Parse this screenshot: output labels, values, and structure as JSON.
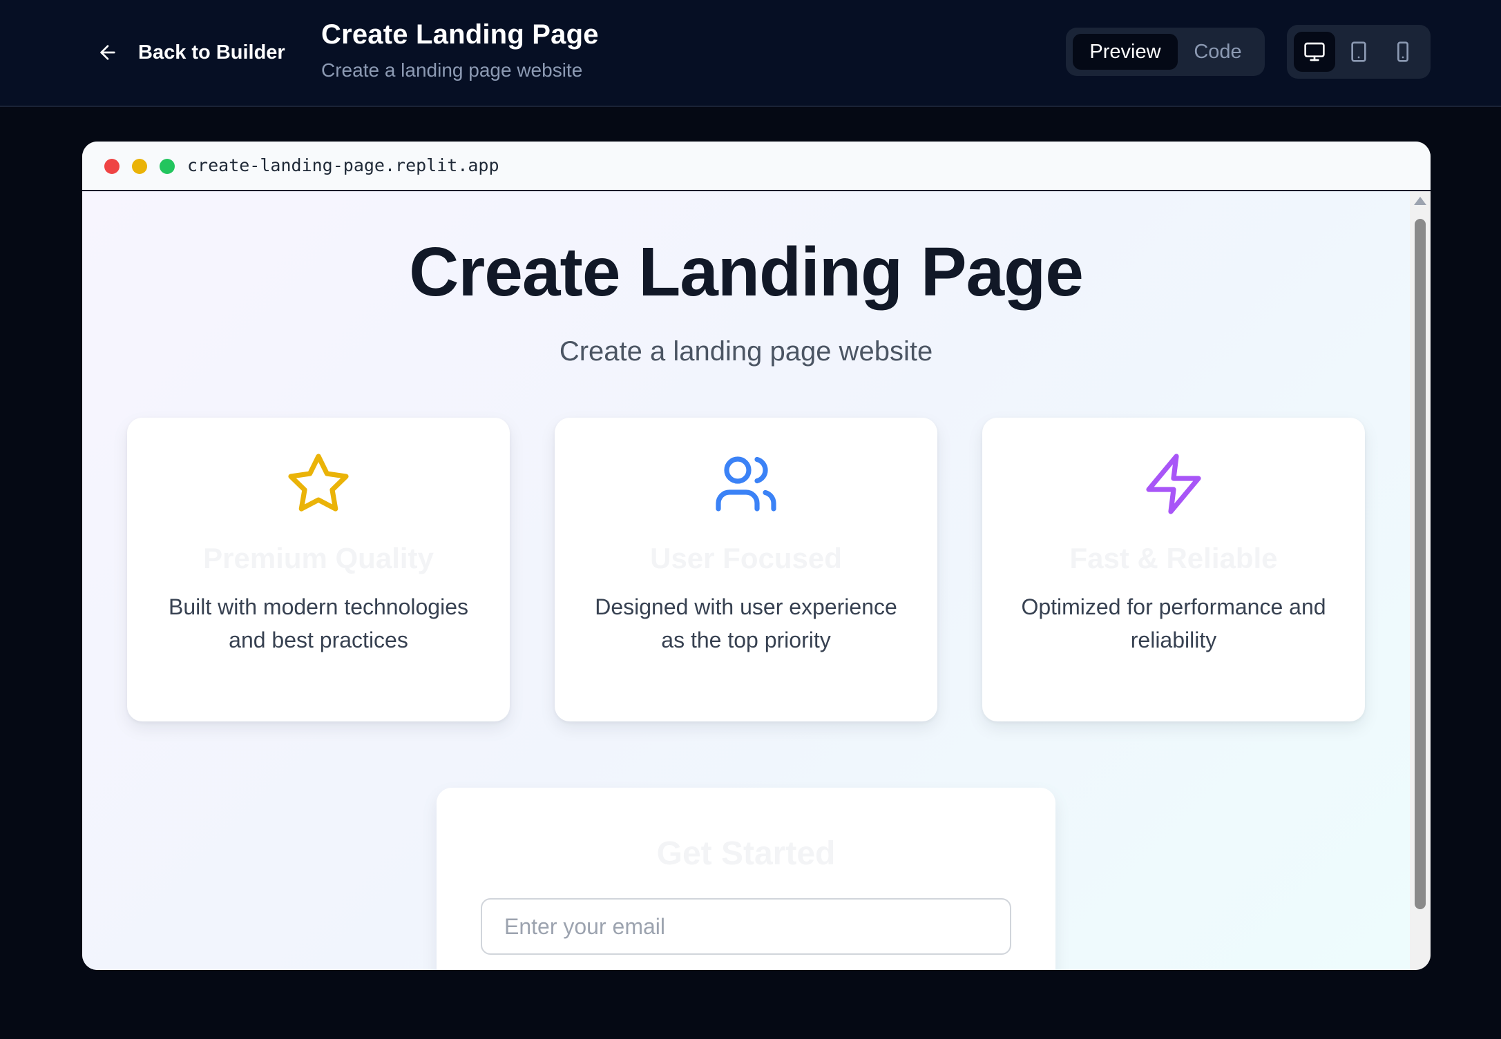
{
  "header": {
    "back_label": "Back to Builder",
    "title": "Create Landing Page",
    "subtitle": "Create a landing page website",
    "view_toggle": {
      "preview_label": "Preview",
      "code_label": "Code",
      "selected": "Preview"
    },
    "devices": {
      "selected": "desktop",
      "items": [
        "desktop-icon",
        "tablet-icon",
        "mobile-icon"
      ]
    }
  },
  "browser": {
    "url": "create-landing-page.replit.app"
  },
  "site": {
    "hero": {
      "title": "Create Landing Page",
      "subtitle": "Create a landing page website"
    },
    "features": [
      {
        "icon": "star-icon",
        "icon_color": "#eab308",
        "title": "Premium Quality",
        "description": "Built with modern technologies and best practices"
      },
      {
        "icon": "users-icon",
        "icon_color": "#3b82f6",
        "title": "User Focused",
        "description": "Designed with user experience as the top priority"
      },
      {
        "icon": "zap-icon",
        "icon_color": "#a855f7",
        "title": "Fast & Reliable",
        "description": "Optimized for performance and reliability"
      }
    ],
    "get_started": {
      "title": "Get Started",
      "email_placeholder": "Enter your email",
      "email_value": ""
    }
  },
  "colors": {
    "app_bg": "#050914",
    "topbar_bg": "#060f24",
    "toggle_bg": "#1a2437",
    "active_bg": "#040916",
    "muted_text": "#8c9ab3"
  }
}
